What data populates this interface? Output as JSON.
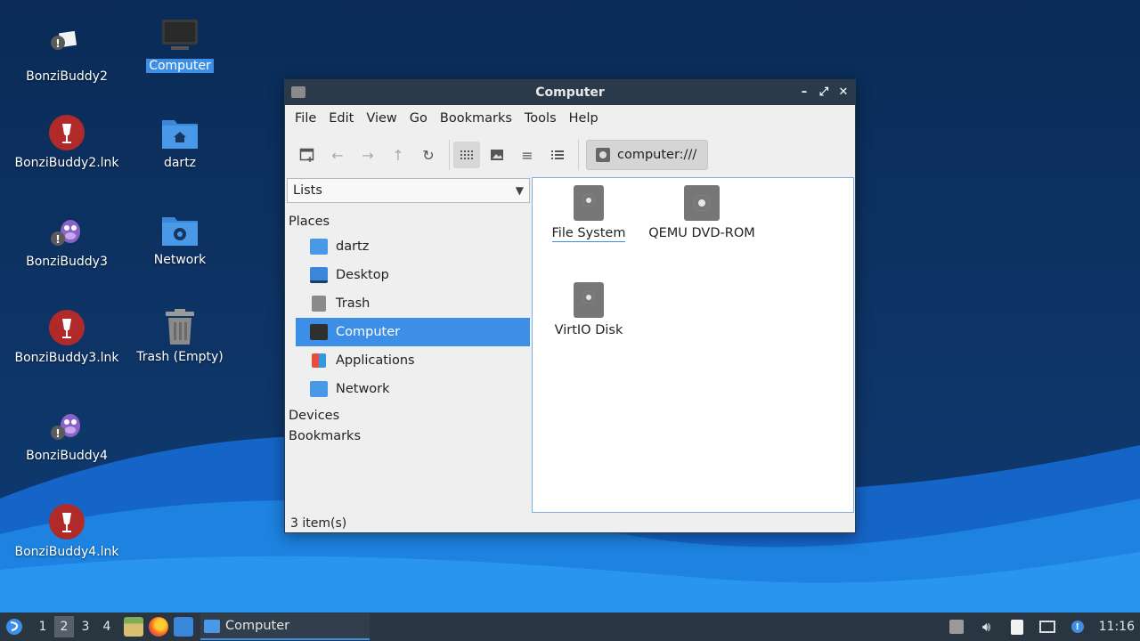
{
  "desktop": {
    "icons": [
      {
        "label": "BonziBuddy2"
      },
      {
        "label": "Computer"
      },
      {
        "label": "BonziBuddy2.lnk"
      },
      {
        "label": "dartz"
      },
      {
        "label": "BonziBuddy3"
      },
      {
        "label": "Network"
      },
      {
        "label": "BonziBuddy3.lnk"
      },
      {
        "label": "Trash (Empty)"
      },
      {
        "label": "BonziBuddy4"
      },
      {
        "label": "BonziBuddy4.lnk"
      }
    ]
  },
  "window": {
    "title": "Computer",
    "menu": [
      "File",
      "Edit",
      "View",
      "Go",
      "Bookmarks",
      "Tools",
      "Help"
    ],
    "location": "computer:///",
    "side_select": "Lists",
    "sections": {
      "places": "Places",
      "devices": "Devices",
      "bookmarks": "Bookmarks"
    },
    "places": [
      {
        "label": "dartz",
        "icon": "home-folder-icon"
      },
      {
        "label": "Desktop",
        "icon": "desktop-icon"
      },
      {
        "label": "Trash",
        "icon": "trash-icon"
      },
      {
        "label": "Computer",
        "icon": "computer-icon",
        "selected": true
      },
      {
        "label": "Applications",
        "icon": "applications-icon"
      },
      {
        "label": "Network",
        "icon": "network-folder-icon"
      }
    ],
    "items": [
      {
        "label": "File System"
      },
      {
        "label": "QEMU DVD-ROM"
      },
      {
        "label": "VirtIO Disk"
      }
    ],
    "status": "3 item(s)"
  },
  "taskbar": {
    "workspaces": [
      "1",
      "2",
      "3",
      "4"
    ],
    "active_workspace": "2",
    "task": "Computer",
    "clock": "11:16"
  },
  "colors": {
    "accent": "#3d8ee6",
    "titlebar": "#2b3a4a",
    "taskbar": "#2a3542"
  }
}
